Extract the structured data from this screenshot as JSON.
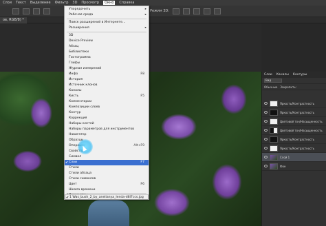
{
  "menubar": {
    "items": [
      "Слои",
      "Текст",
      "Выделение",
      "Фильтр",
      "3D",
      "Просмотр",
      "Окно",
      "Справка"
    ]
  },
  "options": {
    "label": "Режим 3D:"
  },
  "document_tab": {
    "label": "ов, RGB/8) *"
  },
  "window_menu": {
    "items": [
      {
        "label": "Упорядочить",
        "arrow": "▸"
      },
      {
        "label": "Рабочая среда",
        "arrow": "▸"
      },
      {
        "label": "Поиск расширений в Интернете..."
      },
      {
        "label": "Расширения",
        "arrow": "▸"
      },
      {
        "label": "3D"
      },
      {
        "label": "Device Preview"
      },
      {
        "label": "Абзац"
      },
      {
        "label": "Библиотеки"
      },
      {
        "label": "Гистограмма"
      },
      {
        "label": "Глифы"
      },
      {
        "label": "Журнал измерений"
      },
      {
        "label": "Инфо",
        "shortcut": "F8"
      },
      {
        "label": "История"
      },
      {
        "label": "Источник клонов"
      },
      {
        "label": "Каналы"
      },
      {
        "label": "Кисть",
        "shortcut": "F5"
      },
      {
        "label": "Комментарии"
      },
      {
        "label": "Композиции слоев"
      },
      {
        "label": "Контур"
      },
      {
        "label": "Коррекция"
      },
      {
        "label": "Наборы кистей"
      },
      {
        "label": "Наборы параметров для инструментов"
      },
      {
        "label": "Навигатор"
      },
      {
        "label": "Образцы"
      },
      {
        "label": "Операции",
        "shortcut": "Alt+F9"
      },
      {
        "label": "Свойства"
      },
      {
        "label": "Символ"
      },
      {
        "label": "Слои",
        "shortcut": "F7",
        "checked": true
      },
      {
        "label": "Стили"
      },
      {
        "label": "Стили абзаца"
      },
      {
        "label": "Стили символов"
      },
      {
        "label": "Цвет",
        "shortcut": "F6"
      },
      {
        "label": "Шкала времени"
      },
      {
        "label": "Параметры",
        "checked": true
      },
      {
        "label": "Инструменты",
        "checked": true
      },
      {
        "label": "1 Was_bush_2_by_anelianya_lenda-d8l7ccs.jpg",
        "checked": true
      }
    ]
  },
  "layers_panel": {
    "tabs": [
      "Слои",
      "Каналы",
      "Контуры"
    ],
    "kind_filter": "Вид",
    "blend_mode": "Обычные",
    "lock_label": "Закрепить:",
    "layers": [
      {
        "name": "Яркость/Контрастность",
        "thumb": "white"
      },
      {
        "name": "Яркость/Контрастность",
        "thumb": "black"
      },
      {
        "name": "Цветовой тон/Насыщенность",
        "thumb": "white"
      },
      {
        "name": "Цветовой тон/Насыщенность",
        "thumb": "mixed"
      },
      {
        "name": "Яркость/Контрастность",
        "thumb": "black"
      },
      {
        "name": "Яркость/Контрастность",
        "thumb": "white"
      },
      {
        "name": "Слой 1",
        "thumb": "photo",
        "selected": true
      },
      {
        "name": "Фон",
        "thumb": "photo"
      }
    ]
  }
}
